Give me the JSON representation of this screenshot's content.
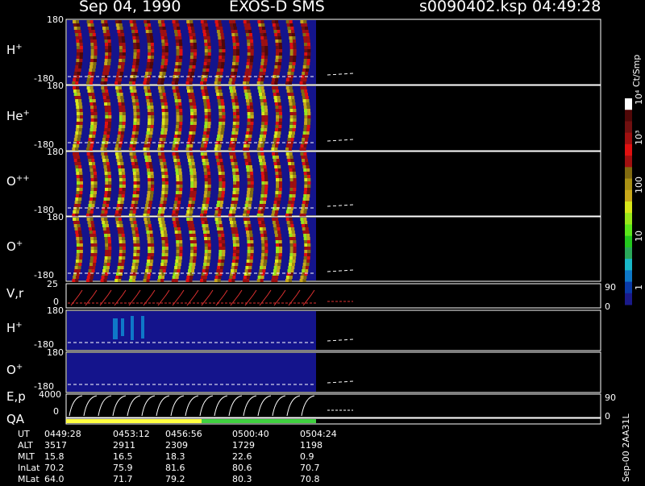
{
  "header": {
    "date": "Sep 04, 1990",
    "instrument": "EXOS-D SMS",
    "file": "s0090402.ksp",
    "time": "04:49:28"
  },
  "side_label": "Sep-00 2AA31L",
  "colorbar": {
    "title": "Ct/Smp",
    "ticks": [
      "1",
      "10",
      "100",
      "10³",
      "10⁴"
    ],
    "colors": [
      "#1a1a8a",
      "#0a3aa8",
      "#0e78c8",
      "#19b8c8",
      "#2aa85a",
      "#23c81e",
      "#5ae61a",
      "#98e61a",
      "#d8e61a",
      "#c8a81a",
      "#a89014",
      "#806a10",
      "#a01010",
      "#e01010",
      "#a01010",
      "#701010",
      "#500808",
      "#ffffff"
    ]
  },
  "chart_data": [
    {
      "type": "heatmap",
      "panel": "H+",
      "label_base": "H",
      "label_sup": "+",
      "ylim": [
        -180,
        180
      ],
      "yticks": [
        "180",
        "-180"
      ]
    },
    {
      "type": "heatmap",
      "panel": "He+",
      "label_base": "He",
      "label_sup": "+",
      "ylim": [
        -180,
        180
      ],
      "yticks": [
        "180",
        "-180"
      ]
    },
    {
      "type": "heatmap",
      "panel": "O++",
      "label_base": "O",
      "label_sup": "++",
      "ylim": [
        -180,
        180
      ],
      "yticks": [
        "180",
        "-180"
      ]
    },
    {
      "type": "heatmap",
      "panel": "O+",
      "label_base": "O",
      "label_sup": "+",
      "ylim": [
        -180,
        180
      ],
      "yticks": [
        "180",
        "-180"
      ]
    },
    {
      "type": "line",
      "panel": "V,r",
      "label_base": "V,r",
      "label_sup": "",
      "ylim": [
        0,
        25
      ],
      "yticks": [
        "25",
        "0"
      ],
      "right_ticks": [
        "90",
        "0"
      ]
    },
    {
      "type": "heatmap",
      "panel": "H+ (2)",
      "label_base": "H",
      "label_sup": "+",
      "ylim": [
        -180,
        180
      ],
      "yticks": [
        "180",
        "-180"
      ]
    },
    {
      "type": "heatmap",
      "panel": "O+ (2)",
      "label_base": "O",
      "label_sup": "+",
      "ylim": [
        -180,
        180
      ],
      "yticks": [
        "180",
        "-180"
      ]
    },
    {
      "type": "line",
      "panel": "E,p",
      "label_base": "E,p",
      "label_sup": "",
      "ylim": [
        0,
        4000
      ],
      "yticks": [
        "4000",
        "0"
      ],
      "right_ticks": [
        "90",
        "0"
      ]
    },
    {
      "type": "bar",
      "panel": "QA",
      "label_base": "QA",
      "label_sup": "",
      "segments": [
        {
          "from": "04:49:28",
          "to": "04:56:56",
          "color": "#ffff40"
        },
        {
          "from": "04:56:56",
          "to": "05:04:24",
          "color": "#40d040"
        }
      ]
    }
  ],
  "orbit_table": {
    "rows": [
      {
        "label": "UT",
        "values": [
          "0449:28",
          "0453:12",
          "0456:56",
          "0500:40",
          "0504:24"
        ]
      },
      {
        "label": "ALT",
        "values": [
          "3517",
          "2911",
          "2309",
          "1729",
          "1198"
        ]
      },
      {
        "label": "MLT",
        "values": [
          "15.8",
          "16.5",
          "18.3",
          "22.6",
          "0.9"
        ]
      },
      {
        "label": "InLat",
        "values": [
          "70.2",
          "75.9",
          "81.6",
          "80.6",
          "70.7"
        ]
      },
      {
        "label": "MLat",
        "values": [
          "64.0",
          "71.7",
          "79.2",
          "80.3",
          "70.8"
        ]
      }
    ]
  }
}
